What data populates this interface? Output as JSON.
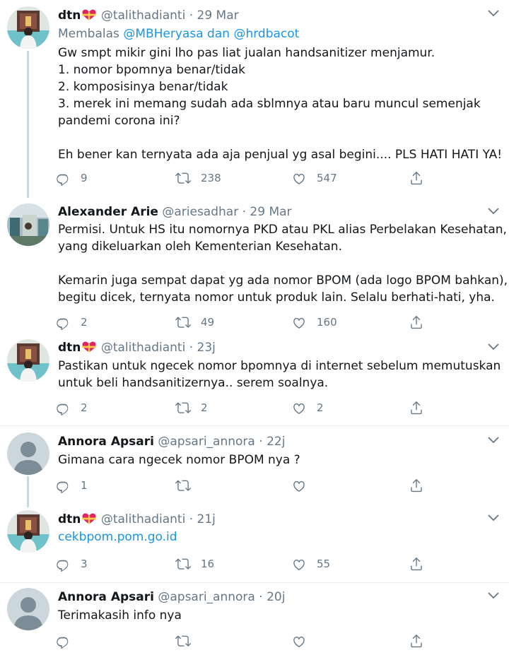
{
  "tweets": [
    {
      "name": "dtn",
      "handle": "@talithadianti",
      "dot": "·",
      "time": "29 Mar",
      "replying_prefix": "Membalas",
      "replying_user1": "@MBHeryasa",
      "replying_and": "dan",
      "replying_user2": "@hrdbacot",
      "lines": [
        "Gw smpt mikir gini lho pas liat jualan handsanitizer menjamur.",
        "1. nomor bpomnya benar/tidak",
        "2. komposisinya benar/tidak",
        "3. merek ini memang sudah ada sblmnya atau baru muncul semenjak",
        "pandemi corona ini?",
        "",
        "Eh bener kan ternyata ada aja penjual yg asal begini.... PLS HATI HATI YA!"
      ],
      "replies": "9",
      "retweets": "238",
      "likes": "547"
    },
    {
      "name": "Alexander Arie",
      "handle": "@ariesadhar",
      "dot": "·",
      "time": "29 Mar",
      "lines": [
        "Permisi. Untuk HS itu nomornya PKD atau PKL alias Perbelakan Kesehatan,",
        "yang dikeluarkan oleh Kementerian Kesehatan.",
        "",
        "Kemarin juga sempat dapat yg ada nomor BPOM (ada logo BPOM bahkan),",
        "begitu dicek, ternyata nomor untuk produk lain. Selalu berhati-hati, yha."
      ],
      "replies": "2",
      "retweets": "49",
      "likes": "160"
    },
    {
      "name": "dtn",
      "handle": "@talithadianti",
      "dot": "·",
      "time": "23j",
      "lines": [
        "Pastikan untuk ngecek nomor bpomnya di internet sebelum memutuskan",
        "untuk beli handsanitizernya.. serem soalnya."
      ],
      "replies": "2",
      "retweets": "2",
      "likes": "2"
    },
    {
      "name": "Annora Apsari",
      "handle": "@apsari_annora",
      "dot": "·",
      "time": "22j",
      "lines": [
        "Gimana cara ngecek nomor BPOM nya ?"
      ],
      "replies": "1",
      "retweets": "",
      "likes": ""
    },
    {
      "name": "dtn",
      "handle": "@talithadianti",
      "dot": "·",
      "time": "21j",
      "link": "cekbpom.pom.go.id",
      "replies": "3",
      "retweets": "16",
      "likes": "55"
    },
    {
      "name": "Annora Apsari",
      "handle": "@apsari_annora",
      "dot": "·",
      "time": "20j",
      "lines": [
        "Terimakasih info nya"
      ],
      "replies": "",
      "retweets": "",
      "likes": ""
    }
  ],
  "icons": {
    "reply": "reply-icon",
    "retweet": "retweet-icon",
    "like": "heart-icon",
    "share": "share-icon",
    "caret": "chevron-down-icon",
    "badge": "heart-ribbon-emoji"
  },
  "colors": {
    "link": "#1b95e0",
    "secondary": "#657786",
    "thread_line": "#ccd6dd",
    "badge": "#e0245e"
  }
}
